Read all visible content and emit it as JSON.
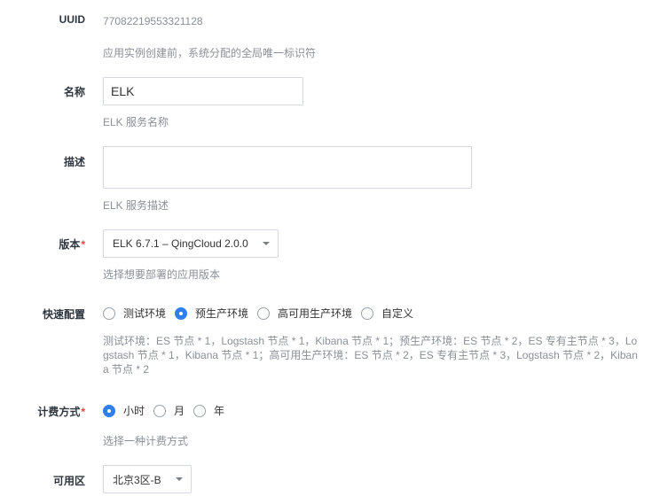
{
  "fields": {
    "uuid": {
      "label": "UUID",
      "value": "77082219553321128",
      "help": "应用实例创建前，系统分配的全局唯一标识符"
    },
    "name": {
      "label": "名称",
      "value": "ELK",
      "help": "ELK 服务名称"
    },
    "description": {
      "label": "描述",
      "value": "",
      "help": "ELK 服务描述"
    },
    "version": {
      "label": "版本",
      "required_mark": "*",
      "selected": "ELK 6.7.1 – QingCloud 2.0.0",
      "help": "选择想要部署的应用版本"
    },
    "quick_config": {
      "label": "快速配置",
      "options": [
        "测试环境",
        "预生产环境",
        "高可用生产环境",
        "自定义"
      ],
      "selected_index": 1,
      "help": "测试环境：ES 节点 * 1，Logstash 节点 * 1，Kibana 节点 * 1；预生产环境：ES 节点 * 2，ES 专有主节点 * 3，Logstash 节点 * 1，Kibana 节点 * 1；高可用生产环境：ES 节点 * 2，ES 专有主节点 * 3，Logstash 节点 * 2，Kibana 节点 * 2"
    },
    "billing": {
      "label": "计费方式",
      "required_mark": "*",
      "options": [
        "小时",
        "月",
        "年"
      ],
      "selected_index": 0,
      "help": "选择一种计费方式"
    },
    "zone": {
      "label": "可用区",
      "selected": "北京3区-B"
    }
  },
  "colors": {
    "accent": "#2f80ed",
    "required": "#e0443a",
    "help_text": "#8b8f96",
    "border": "#d5d9df"
  },
  "icons": {
    "select_caret": "chevron-down-icon"
  }
}
